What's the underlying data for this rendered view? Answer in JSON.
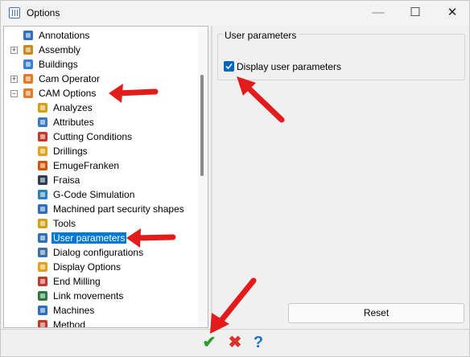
{
  "window": {
    "title": "Options"
  },
  "titlebar": {
    "minimize": "—",
    "maximize": "☐",
    "close": "✕"
  },
  "tree": {
    "items": [
      {
        "label": "Annotations",
        "icon": "annotations-icon",
        "color": "#2f6fc2",
        "expander": ""
      },
      {
        "label": "Assembly",
        "icon": "assembly-icon",
        "color": "#c98a1e",
        "expander": "+"
      },
      {
        "label": "Buildings",
        "icon": "buildings-icon",
        "color": "#3c7fd1",
        "expander": ""
      },
      {
        "label": "Cam Operator",
        "icon": "cam-operator-icon",
        "color": "#e07b2a",
        "expander": "+"
      },
      {
        "label": "CAM Options",
        "icon": "cam-options-icon",
        "color": "#e07b2a",
        "expander": "−"
      },
      {
        "label": "Analyzes",
        "icon": "analyzes-icon",
        "color": "#d4a017"
      },
      {
        "label": "Attributes",
        "icon": "attributes-icon",
        "color": "#3b78c4"
      },
      {
        "label": "Cutting Conditions",
        "icon": "cutting-conditions-icon",
        "color": "#c0392b"
      },
      {
        "label": "Drillings",
        "icon": "drillings-icon",
        "color": "#e2a21b"
      },
      {
        "label": "EmugeFranken",
        "icon": "emugefranken-icon",
        "color": "#d35400"
      },
      {
        "label": "Fraisa",
        "icon": "fraisa-icon",
        "color": "#2c3e50"
      },
      {
        "label": "G-Code Simulation",
        "icon": "gcode-simulation-icon",
        "color": "#2980b9"
      },
      {
        "label": "Machined part security shapes",
        "icon": "security-shapes-icon",
        "color": "#2d6fb8"
      },
      {
        "label": "Tools",
        "icon": "tools-icon",
        "color": "#d4a017"
      },
      {
        "label": "User parameters",
        "icon": "user-parameters-icon",
        "color": "#2d6fb8",
        "selected": true
      },
      {
        "label": "Dialog configurations",
        "icon": "dialog-configurations-icon",
        "color": "#3a6ea5"
      },
      {
        "label": "Display Options",
        "icon": "display-options-icon",
        "color": "#e2a21b"
      },
      {
        "label": "End Milling",
        "icon": "end-milling-icon",
        "color": "#c0392b"
      },
      {
        "label": "Link movements",
        "icon": "link-movements-icon",
        "color": "#2c7a3f"
      },
      {
        "label": "Machines",
        "icon": "machines-icon",
        "color": "#2d6fb8"
      },
      {
        "label": "Method",
        "icon": "method-icon",
        "color": "#c0392b"
      }
    ]
  },
  "panel": {
    "group_title": "User parameters",
    "checkbox_label": "Display user parameters",
    "checkbox_checked": true,
    "reset_label": "Reset"
  },
  "footer": {
    "ok": "✔",
    "cancel": "✖",
    "help": "?"
  },
  "colors": {
    "accent": "#0078d7",
    "arrow": "#e31b1b"
  }
}
